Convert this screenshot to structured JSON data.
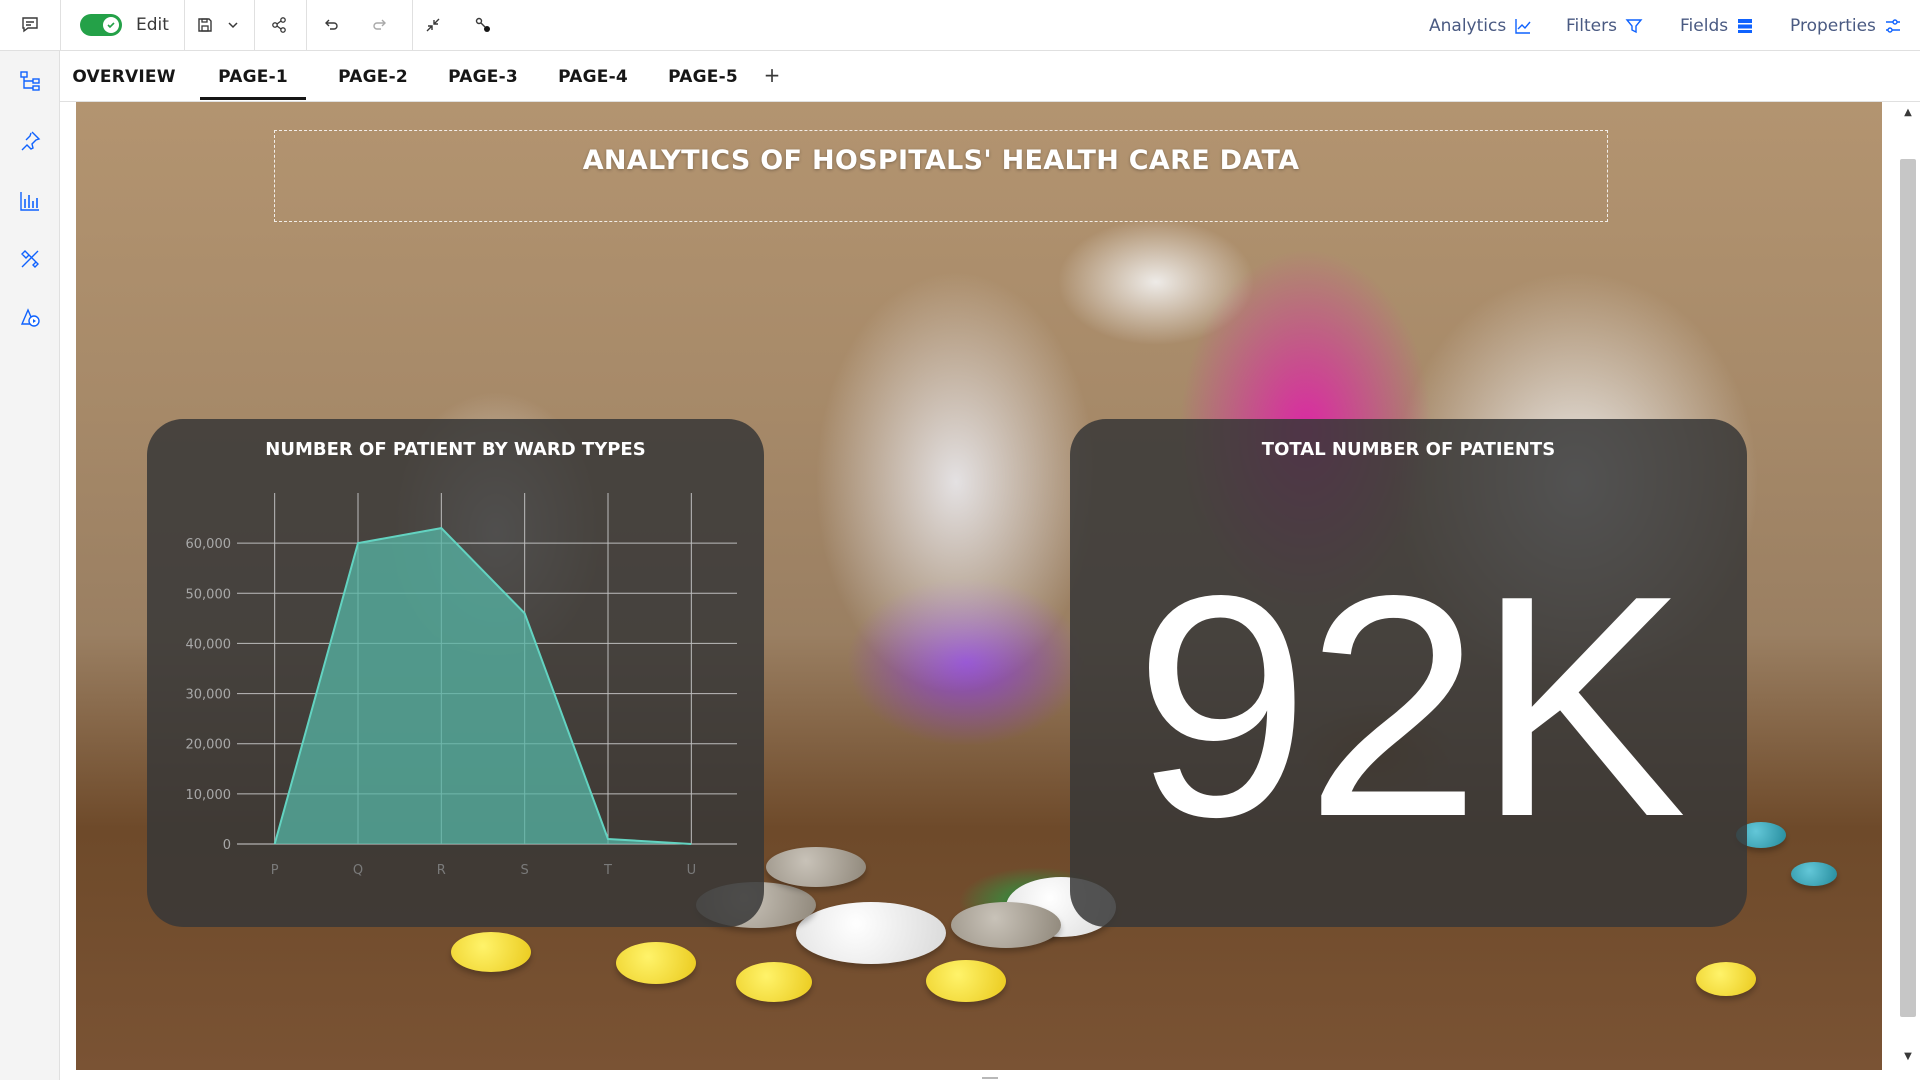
{
  "toolbar": {
    "edit_label": "Edit",
    "edit_mode_on": true,
    "right_menu": [
      {
        "label": "Analytics",
        "icon": "analytics-chart-icon"
      },
      {
        "label": "Filters",
        "icon": "filter-icon"
      },
      {
        "label": "Fields",
        "icon": "fields-icon"
      },
      {
        "label": "Properties",
        "icon": "properties-sliders-icon"
      }
    ]
  },
  "tabs": [
    {
      "label": "OVERVIEW",
      "active": false
    },
    {
      "label": "PAGE-1",
      "active": true
    },
    {
      "label": "PAGE-2",
      "active": false
    },
    {
      "label": "PAGE-3",
      "active": false
    },
    {
      "label": "PAGE-4",
      "active": false
    },
    {
      "label": "PAGE-5",
      "active": false
    }
  ],
  "add_tab_label": "+",
  "dashboard": {
    "title": "ANALYTICS OF HOSPITALS' HEALTH CARE DATA",
    "chart_card_title": "NUMBER OF PATIENT BY WARD TYPES",
    "kpi_card_title": "TOTAL NUMBER OF PATIENTS",
    "kpi_value": "92K"
  },
  "colors": {
    "accent_green": "#24a148",
    "area_fill": "#56b5a6",
    "area_line": "#63d3c1",
    "card_bg": "rgba(55,55,55,0.85)"
  },
  "chart_data": {
    "type": "area",
    "title": "NUMBER OF PATIENT BY WARD TYPES",
    "categories": [
      "P",
      "Q",
      "R",
      "S",
      "T",
      "U"
    ],
    "values": [
      0,
      60000,
      63000,
      46000,
      1000,
      0
    ],
    "y_ticks": [
      "0",
      "10,000",
      "20,000",
      "30,000",
      "40,000",
      "50,000",
      "60,000"
    ],
    "ylim": [
      0,
      60000
    ],
    "grid": true,
    "xlabel": "",
    "ylabel": ""
  }
}
